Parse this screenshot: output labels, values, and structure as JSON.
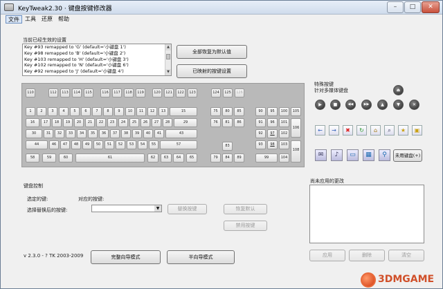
{
  "window": {
    "title": "KeyTweak2.30 · 键盘按键修改器",
    "minimize": "–",
    "maximize": "□",
    "close": "✕"
  },
  "menu": [
    "文件",
    "工具",
    "还原",
    "帮助"
  ],
  "current_label": "当前已经生效的设置",
  "remaps": [
    "Key #93 remapped to 'G' (default='小键盘 1')",
    "Key #98 remapped to 'B' (default='小键盘 2')",
    "Key #103 remapped to 'H' (default='小键盘 3')",
    "Key #102 remapped to 'N' (default='小键盘 6')",
    "Key #92 remapped to 'J' (default='小键盘 4')"
  ],
  "buttons": {
    "restore_all": "全部恢复为默认值",
    "show_remapped": "已映射的按键设置",
    "remap_key": "替换按键",
    "restore_default": "恢复默认",
    "disable_key": "禁用按键",
    "full_mode": "完整向导模式",
    "half_mode": "半向导模式",
    "apply": "应用",
    "delete": "删除",
    "clear": "清空",
    "raw_map": "未用键盘(+)"
  },
  "special": {
    "title": "特殊按键",
    "subtitle": "针对多媒体键盘"
  },
  "icons": {
    "eject": "eject-icon",
    "media_row": [
      {
        "name": "play-icon",
        "glyph": "▶"
      },
      {
        "name": "stop-icon",
        "glyph": "■"
      },
      {
        "name": "prev-track-icon",
        "glyph": "◀◀"
      },
      {
        "name": "next-track-icon",
        "glyph": "▶▶"
      },
      {
        "name": "volume-up-icon",
        "glyph": "▲"
      },
      {
        "name": "volume-down-icon",
        "glyph": "▼"
      },
      {
        "name": "mute-icon",
        "glyph": "✕"
      }
    ],
    "web_row": [
      {
        "name": "back-icon",
        "glyph": "←"
      },
      {
        "name": "forward-icon",
        "glyph": "→"
      },
      {
        "name": "stop-web-icon",
        "glyph": "✖"
      },
      {
        "name": "refresh-icon",
        "glyph": "↻"
      },
      {
        "name": "home-icon",
        "glyph": "⌂"
      },
      {
        "name": "search-icon",
        "glyph": "⌕"
      },
      {
        "name": "favorites-icon",
        "glyph": "★"
      },
      {
        "name": "folder-icon",
        "glyph": "▣"
      }
    ],
    "launch_row": [
      {
        "name": "mail-icon",
        "glyph": "✉"
      },
      {
        "name": "media-select-icon",
        "glyph": "♪"
      },
      {
        "name": "my-computer-icon",
        "glyph": "▭"
      },
      {
        "name": "calculator-icon",
        "glyph": "▦"
      },
      {
        "name": "magnifier-icon",
        "glyph": "⚲"
      }
    ]
  },
  "key_control": {
    "title": "键盘控制",
    "selected_key": "选定的键:",
    "mapped_to": "对应的按键:",
    "choose_remap": "选择替换后的按键:",
    "combo_value": ""
  },
  "pending_label": "尚未应用的更改",
  "version": "v 2.3.0 - ? TK 2003-2009",
  "watermark": "3DMGAME",
  "keys": {
    "fn_row": [
      "110",
      "112",
      "113",
      "114",
      "115",
      "116",
      "117",
      "118",
      "119",
      "120",
      "121",
      "122",
      "123",
      "124",
      "125",
      "126"
    ],
    "row1": [
      "1",
      "2",
      "3",
      "4",
      "5",
      "6",
      "7",
      "8",
      "9",
      "10",
      "11",
      "12",
      "13",
      "15"
    ],
    "row2": [
      "16",
      "17",
      "18",
      "19",
      "20",
      "21",
      "22",
      "23",
      "24",
      "25",
      "26",
      "27",
      "28",
      "29"
    ],
    "row3": [
      "30",
      "31",
      "32",
      "33",
      "34",
      "35",
      "36",
      "37",
      "38",
      "39",
      "40",
      "41",
      "43"
    ],
    "row4": [
      "44",
      "46",
      "47",
      "48",
      "49",
      "50",
      "51",
      "52",
      "53",
      "54",
      "55",
      "57"
    ],
    "row5": [
      "58",
      "59",
      "60",
      "61",
      "62",
      "63",
      "64",
      "65"
    ],
    "nav1": [
      "75",
      "80",
      "85"
    ],
    "nav2": [
      "76",
      "81",
      "86"
    ],
    "arrows": [
      "83",
      "79",
      "84",
      "89"
    ],
    "num1": [
      "90",
      "95",
      "100",
      "105"
    ],
    "num2": [
      "91",
      "96",
      "101"
    ],
    "num3": [
      "92",
      "97",
      "102"
    ],
    "num4": [
      "93",
      "98",
      "103"
    ],
    "num5": [
      "99",
      "104"
    ],
    "num_plus": "106",
    "num_enter": "108"
  }
}
